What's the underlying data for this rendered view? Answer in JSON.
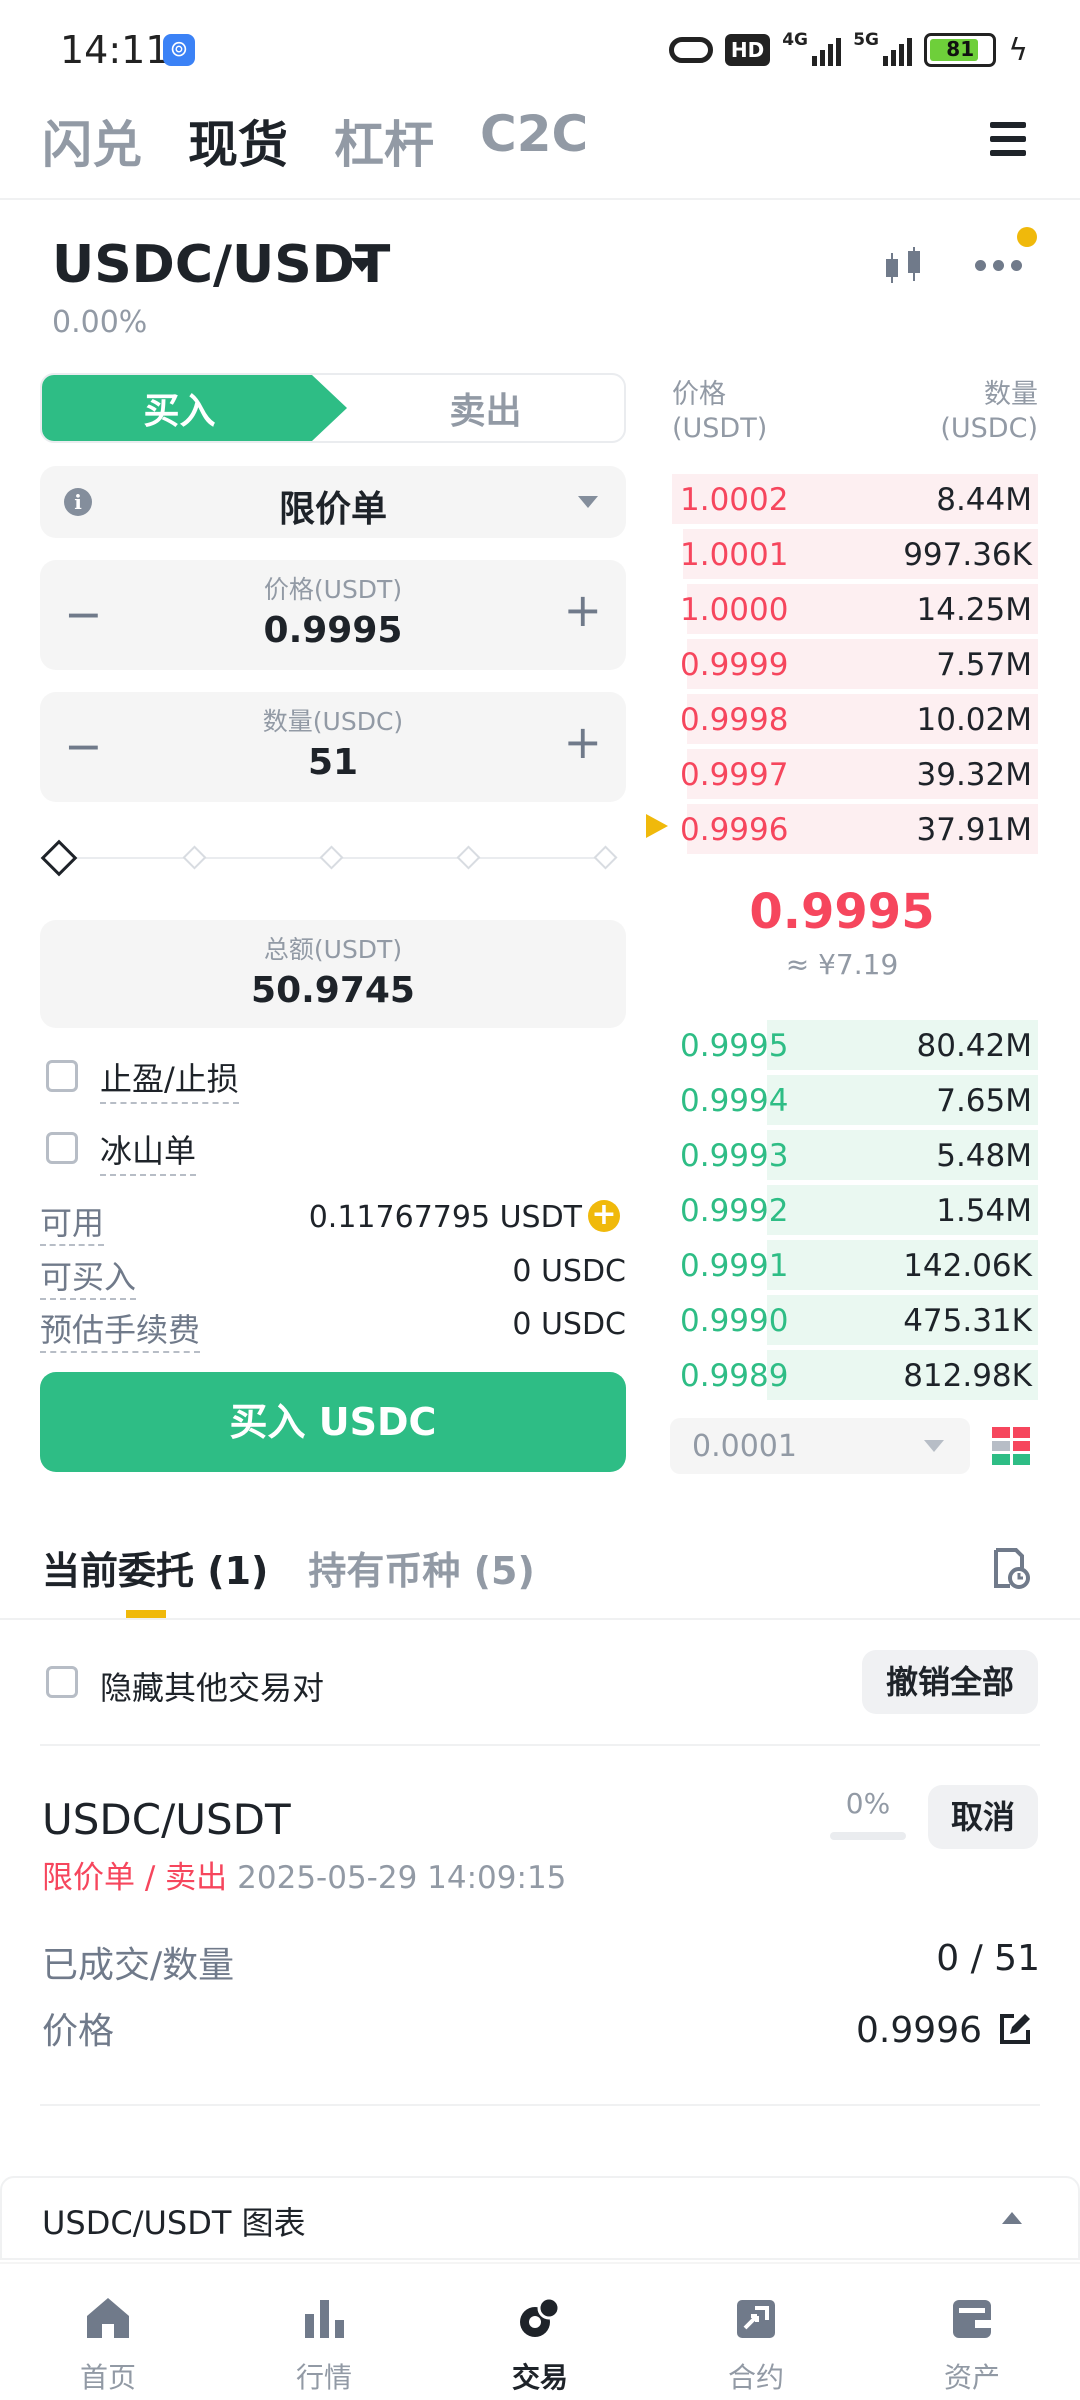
{
  "status_bar": {
    "time": "14:11",
    "network_1": "4G",
    "network_2": "5G",
    "hd": "HD",
    "battery": "81"
  },
  "top_tabs": [
    "闪兑",
    "现货",
    "杠杆",
    "C2C"
  ],
  "active_top_tab": 1,
  "pair": {
    "symbol": "USDC/USDT",
    "change": "0.00%"
  },
  "order_form": {
    "buy_label": "买入",
    "sell_label": "卖出",
    "order_type": "限价单",
    "price_caption": "价格(USDT)",
    "price_value": "0.9995",
    "qty_caption": "数量(USDC)",
    "qty_value": "51",
    "total_caption": "总额(USDT)",
    "total_value": "50.9745",
    "tp_sl_label": "止盈/止损",
    "iceberg_label": "冰山单",
    "available_label": "可用",
    "available_value": "0.11767795 USDT",
    "max_buy_label": "可买入",
    "max_buy_value": "0 USDC",
    "fee_label": "预估手续费",
    "fee_value": "0 USDC",
    "submit_label": "买入 USDC"
  },
  "order_book": {
    "price_header": "价格",
    "price_unit": "(USDT)",
    "qty_header": "数量",
    "qty_unit": "(USDC)",
    "asks": [
      {
        "price": "1.0002",
        "qty": "8.44M",
        "depth": 1.0
      },
      {
        "price": "1.0001",
        "qty": "997.36K",
        "depth": 0.97
      },
      {
        "price": "1.0000",
        "qty": "14.25M",
        "depth": 0.96
      },
      {
        "price": "0.9999",
        "qty": "7.57M",
        "depth": 0.96
      },
      {
        "price": "0.9998",
        "qty": "10.02M",
        "depth": 0.96
      },
      {
        "price": "0.9997",
        "qty": "39.32M",
        "depth": 0.96
      },
      {
        "price": "0.9996",
        "qty": "37.91M",
        "depth": 0.96
      }
    ],
    "mid_price": "0.9995",
    "mid_fiat": "≈ ¥7.19",
    "bids": [
      {
        "price": "0.9995",
        "qty": "80.42M",
        "depth": 0.74
      },
      {
        "price": "0.9994",
        "qty": "7.65M",
        "depth": 0.74
      },
      {
        "price": "0.9993",
        "qty": "5.48M",
        "depth": 0.74
      },
      {
        "price": "0.9992",
        "qty": "1.54M",
        "depth": 0.74
      },
      {
        "price": "0.9991",
        "qty": "142.06K",
        "depth": 0.74
      },
      {
        "price": "0.9990",
        "qty": "475.31K",
        "depth": 0.74
      },
      {
        "price": "0.9989",
        "qty": "812.98K",
        "depth": 0.74
      }
    ],
    "precision": "0.0001"
  },
  "orders_section": {
    "tab_open": "当前委托 (1)",
    "tab_holdings": "持有币种 (5)",
    "hide_other_pairs": "隐藏其他交易对",
    "cancel_all": "撤销全部",
    "order": {
      "pair": "USDC/USDT",
      "type_side": "限价单 / 卖出",
      "time": "2025-05-29 14:09:15",
      "fill_pct": "0%",
      "fill_ratio": 0,
      "cancel": "取消",
      "filled_label": "已成交/数量",
      "filled_value": "0 / 51",
      "price_label": "价格",
      "price_value": "0.9996"
    }
  },
  "chart_bar_label": "USDC/USDT 图表",
  "bottom_nav": [
    "首页",
    "行情",
    "交易",
    "合约",
    "资产"
  ],
  "active_bottom_nav": 2,
  "colors": {
    "buy": "#2ebd85",
    "sell": "#f6465d",
    "accent": "#f0b90b",
    "text": "#1e2329",
    "muted": "#929aa5"
  }
}
